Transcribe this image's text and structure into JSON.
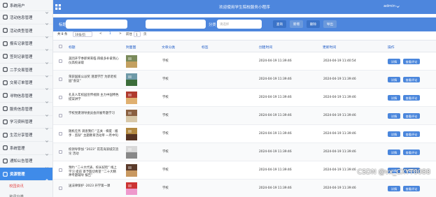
{
  "header": {
    "title": "欢迎使用学生院校服务小程序",
    "user": "admin"
  },
  "sidebar": {
    "items": [
      {
        "label": "系统用户"
      },
      {
        "label": "活动信息管理"
      },
      {
        "label": "活动类型管理"
      },
      {
        "label": "报名记录管理"
      },
      {
        "label": "签到记录管理"
      },
      {
        "label": "二手交易管理"
      },
      {
        "label": "交易订单管理"
      },
      {
        "label": "寻物信息管理"
      },
      {
        "label": "服务信息管理"
      },
      {
        "label": "学习资料管理"
      },
      {
        "label": "生活分享管理"
      },
      {
        "label": "系统管理"
      },
      {
        "label": "通知公告管理"
      },
      {
        "label": "资源管理"
      }
    ],
    "sub_active": "校园资讯",
    "sub_next": "资讯分类"
  },
  "filter": {
    "title_label": "标题",
    "label_label": "标签",
    "category_label": "分类",
    "category_placeholder": "请选择",
    "search_btn": "查询",
    "add_btn": "新增",
    "delete_btn": "删除",
    "export_btn": "导出"
  },
  "pager": {
    "total": "共 8 条",
    "page_size": "10条/页",
    "prev": "<",
    "page": "1",
    "next": ">",
    "goto_label": "前往",
    "goto_value": "1",
    "goto_unit": "页"
  },
  "table": {
    "headers": [
      "标题",
      "封面图",
      "文章分类",
      "标签",
      "创建时间",
      "更新时间",
      "操作"
    ],
    "rows": [
      {
        "title": "美团开学季即将来临 四级多补拿到心仪高校录取",
        "category": "学校",
        "created": "2024-04-19 11:39:46",
        "updated": "2024-04-19 11:40:54",
        "thumb": "campus-photo",
        "colors": [
          "#7a8a5a",
          "#c3a060"
        ]
      },
      {
        "title": "荣获国家公派奖 港澳学厅 为新老校园“会议”",
        "category": "学校",
        "created": "2024-04-19 11:39:46",
        "updated": "2024-04-19 11:39:46",
        "thumb": "lake-photo",
        "colors": [
          "#6f9aa8",
          "#3c6d3a"
        ]
      },
      {
        "title": "孔夫人年校园宣传视频 主力中国特色 提案讲学",
        "category": "学校",
        "created": "2024-04-19 11:39:46",
        "updated": "2024-04-19 11:39:46",
        "thumb": "poster-photo",
        "colors": [
          "#b03a2e",
          "#e0b070"
        ]
      },
      {
        "title": "学校党建领导委员会开展专题学习",
        "category": "学校",
        "created": "2024-04-19 11:39:46",
        "updated": "2024-04-19 11:39:46",
        "thumb": "meeting-photo",
        "colors": [
          "#8a6040",
          "#d8c8a8"
        ]
      },
      {
        "title": "随机任务 调查我们 “五关 · 梯度 · 搬手 · 监狱” 主题教育活动单 一月中旬",
        "category": "学校",
        "created": "2024-04-19 11:39:46",
        "updated": "2024-04-19 11:39:46",
        "thumb": "auditorium-photo",
        "colors": [
          "#b28840",
          "#553322"
        ]
      },
      {
        "title": "校领导参加 “2023” 花花海滨城交流 论 活动",
        "category": "学校",
        "created": "2024-04-19 11:39:46",
        "updated": "2024-04-19 11:39:46",
        "thumb": "document-photo",
        "colors": [
          "#d8d8d8",
          "#888888"
        ]
      },
      {
        "title": "预约 “二十大代表、校长纪检” 线上学习 提前 寄予殷切希望 “二十大精神专题辅导 报告”",
        "category": "学校",
        "created": "2024-04-19 11:39:46",
        "updated": "2024-04-19 11:39:46",
        "thumb": "stage-photo",
        "colors": [
          "#5a3a2a",
          "#c89860"
        ]
      },
      {
        "title": "送法律保护 ·2023 开学第一课",
        "category": "学校",
        "created": "2024-04-19 11:39:46",
        "updated": "2024-04-19 11:39:46",
        "thumb": "flag-photo",
        "colors": [
          "#c33",
          "#e9c"
        ]
      }
    ],
    "detail_btn": "详情",
    "edit_btn": "查看评论"
  },
  "watermark": "CSDN @vx_CXYT0088"
}
